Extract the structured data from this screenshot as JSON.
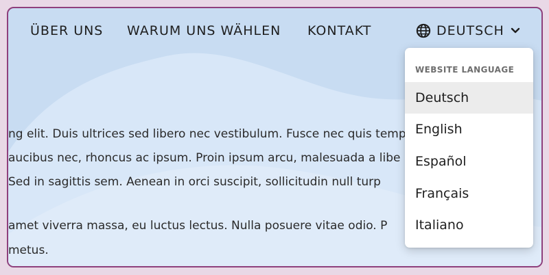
{
  "nav": {
    "links": [
      "ÜBER UNS",
      "WARUM UNS WÄHLEN",
      "KONTAKT"
    ],
    "language_button": {
      "icon": "globe-icon",
      "label": "DEUTSCH",
      "caret_icon": "chevron-down-icon"
    }
  },
  "content": {
    "lines": [
      "ng elit. Duis ultrices sed libero nec vestibulum. Fusce nec quis tempor",
      "aucibus nec, rhoncus ac ipsum. Proin ipsum arcu, malesuada a libe",
      " Sed in sagittis sem. Aenean in orci suscipit, sollicitudin null turp",
      "amet viverra massa, eu luctus lectus. Nulla posuere vitae odio. P",
      " metus."
    ]
  },
  "language_menu": {
    "header": "WEBSITE LANGUAGE",
    "items": [
      "Deutsch",
      "English",
      "Español",
      "Français",
      "Italiano"
    ],
    "selected": "Deutsch"
  },
  "colors": {
    "page_background": "#e9d8e6",
    "frame_border": "#8e3f7c",
    "hero_background": "#c8dcf2",
    "selected_item": "#ececec"
  }
}
